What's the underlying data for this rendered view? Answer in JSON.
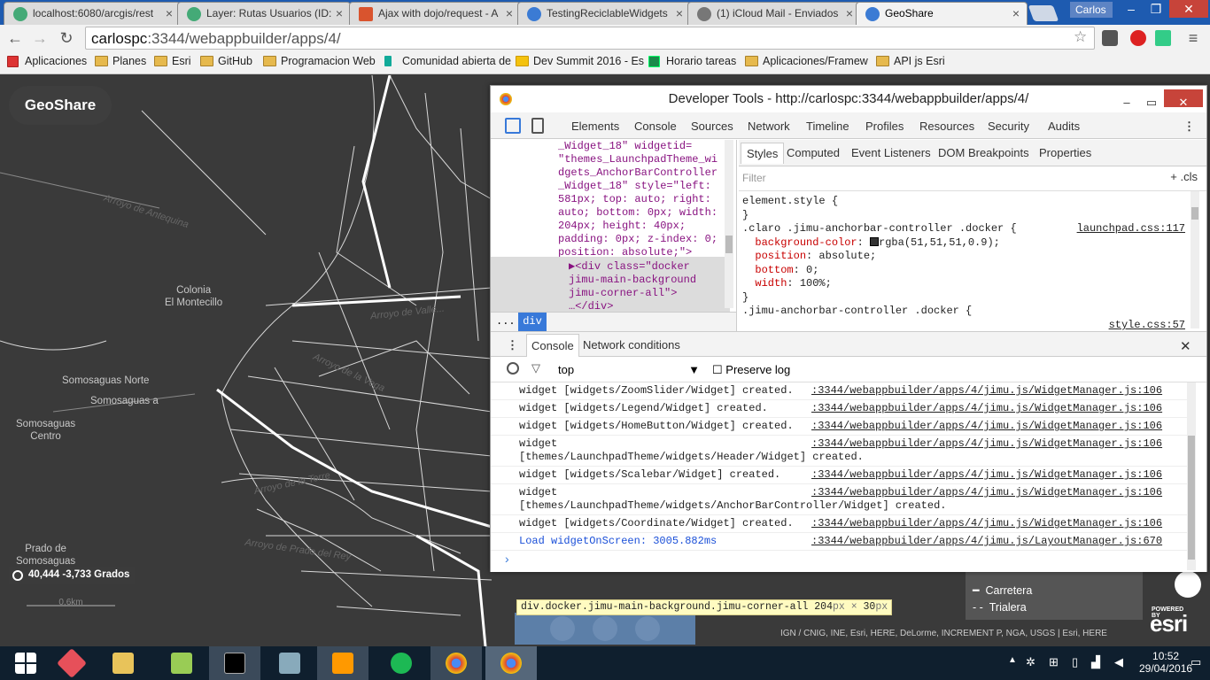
{
  "browser": {
    "tabs": [
      {
        "label": "localhost:6080/arcgis/rest"
      },
      {
        "label": "Layer: Rutas Usuarios (ID:"
      },
      {
        "label": "Ajax with dojo/request - A"
      },
      {
        "label": "TestingReciclableWidgets"
      },
      {
        "label": "(1) iCloud Mail - Enviados"
      },
      {
        "label": "GeoShare"
      }
    ],
    "user": "Carlos",
    "url_host": "carlospc",
    "url_path": ":3344/webappbuilder/apps/4/",
    "bookmarks": [
      {
        "label": "Aplicaciones"
      },
      {
        "label": "Planes"
      },
      {
        "label": "Esri"
      },
      {
        "label": "GitHub"
      },
      {
        "label": "Programacion Web"
      },
      {
        "label": "Comunidad abierta de"
      },
      {
        "label": "Dev Summit 2016 - Es"
      },
      {
        "label": "Horario tareas"
      },
      {
        "label": "Aplicaciones/Framew"
      },
      {
        "label": "API js Esri"
      }
    ]
  },
  "map": {
    "app_title": "GeoShare",
    "places": [
      {
        "label": "Colonia\nEl Montecillo"
      },
      {
        "label": "Somosaguas Norte"
      },
      {
        "label": "Somosaguas a"
      },
      {
        "label": "Somosaguas\nCentro"
      },
      {
        "label": "Prado de\nSomosaguas"
      }
    ],
    "roads": [
      {
        "label": "Arroyo de Antequina"
      },
      {
        "label": "Arroyo de Valle..."
      },
      {
        "label": "Arroyo de la Vega"
      },
      {
        "label": "Arroyo de la Torre"
      },
      {
        "label": "Arroyo de Prado del Rey"
      }
    ],
    "coordinates": "40,444 -3,733 Grados",
    "scale_label": "0,6km",
    "legend": [
      {
        "label": "Carretera"
      },
      {
        "label": "Trialera"
      }
    ],
    "attribution": "IGN / CNIG, INE, Esri, HERE, DeLorme, INCREMENT P, NGA, USGS | Esri, HERE",
    "esri_powered": "POWERED BY",
    "esri_logo": "esri",
    "tooltip_selector": "div.docker.jimu-main-background.jimu-corner-all",
    "tooltip_size": "204",
    "tooltip_unit": "px",
    "tooltip_sep": "×",
    "tooltip_height": "30",
    "tooltip_unit2": "px"
  },
  "devtools": {
    "title": "Developer Tools - http://carlospc:3344/webappbuilder/apps/4/",
    "tabs": [
      "Elements",
      "Console",
      "Sources",
      "Network",
      "Timeline",
      "Profiles",
      "Resources",
      "Security",
      "Audits"
    ],
    "element_code": "_Widget_18\" widgetid=\n\"themes_LaunchpadTheme_wi\ndgets_AnchorBarController\n_Widget_18\" style=\"left:\n581px; top: auto; right:\nauto; bottom: 0px; width:\n204px; height: 40px;\npadding: 0px; z-index: 0;\nposition: absolute;\">",
    "selected_code": "▶<div class=\"docker\njimu-main-background\njimu-corner-all\">\n…</div>",
    "breadcrumb_dots": "...",
    "breadcrumb_sel": "div",
    "styles_tabs": [
      "Styles",
      "Computed",
      "Event Listeners",
      "DOM Breakpoints",
      "Properties"
    ],
    "filter_placeholder": "Filter",
    "filter_tools": "+ .cls",
    "css_element_style": "element.style {\n}",
    "css_rule_selector": ".claro .jimu-anchorbar-controller .docker {",
    "css_rule_src": "launchpad.css:117",
    "css_props": [
      {
        "name": "background-color",
        "value": "rgba(51,51,51,0.9);"
      },
      {
        "name": "position",
        "value": "absolute;"
      },
      {
        "name": "bottom",
        "value": "0;"
      },
      {
        "name": "width",
        "value": "100%;"
      }
    ],
    "css_next_selector": ".jimu-anchorbar-controller .docker {",
    "css_next_src": "style.css:57",
    "drawer_tabs": [
      "Console",
      "Network conditions"
    ],
    "console_context": "top",
    "preserve_log": "Preserve log",
    "console_rows": [
      {
        "msg": "widget [widgets/ZoomSlider/Widget] created.",
        "src": ":3344/webappbuilder/apps/4/jimu.js/WidgetManager.js:106"
      },
      {
        "msg": "widget [widgets/Legend/Widget] created.",
        "src": ":3344/webappbuilder/apps/4/jimu.js/WidgetManager.js:106"
      },
      {
        "msg": "widget [widgets/HomeButton/Widget] created.",
        "src": ":3344/webappbuilder/apps/4/jimu.js/WidgetManager.js:106"
      },
      {
        "msg": "widget\n[themes/LaunchpadTheme/widgets/Header/Widget] created.",
        "src": ":3344/webappbuilder/apps/4/jimu.js/WidgetManager.js:106"
      },
      {
        "msg": "widget [widgets/Scalebar/Widget] created.",
        "src": ":3344/webappbuilder/apps/4/jimu.js/WidgetManager.js:106"
      },
      {
        "msg": "widget\n[themes/LaunchpadTheme/widgets/AnchorBarController/Widget] created.",
        "src": ":3344/webappbuilder/apps/4/jimu.js/WidgetManager.js:106"
      },
      {
        "msg": "widget [widgets/Coordinate/Widget] created.",
        "src": ":3344/webappbuilder/apps/4/jimu.js/WidgetManager.js:106"
      },
      {
        "msg": "Load widgetOnScreen: 3005.882ms",
        "src": ":3344/webappbuilder/apps/4/jimu.js/LayoutManager.js:670"
      }
    ]
  },
  "taskbar": {
    "time": "10:52",
    "date": "29/04/2016"
  }
}
